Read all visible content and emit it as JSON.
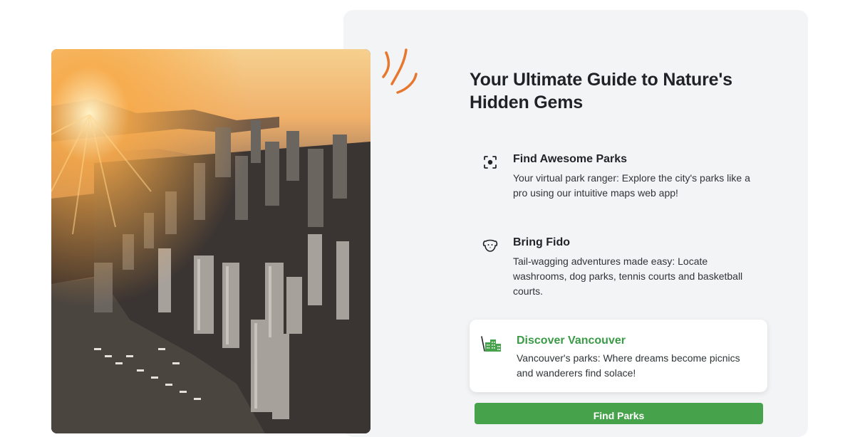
{
  "hero": {
    "title": "Your Ultimate Guide to Nature's Hidden Gems",
    "image_icon": "city-skyline-photo",
    "decoration_icon": "orange-squiggle-icon"
  },
  "features": [
    {
      "icon": "focus-target-icon",
      "heading": "Find Awesome Parks",
      "body": "Your virtual park ranger: Explore the city's parks like a pro using our intuitive maps web app!"
    },
    {
      "icon": "dog-face-icon",
      "heading": "Bring Fido",
      "body": "Tail-wagging adventures made easy: Locate washrooms, dog parks, tennis courts and basketball courts."
    },
    {
      "icon": "city-buildings-icon",
      "heading": "Discover Vancouver",
      "body": "Vancouver's parks: Where dreams become picnics and wanderers find solace!",
      "highlighted": true
    }
  ],
  "cta": {
    "label": "Find Parks"
  },
  "colors": {
    "accent": "#46a34b",
    "accent_text": "#3a9b46",
    "squiggle": "#e8772e",
    "panel_bg": "#f3f4f6"
  }
}
